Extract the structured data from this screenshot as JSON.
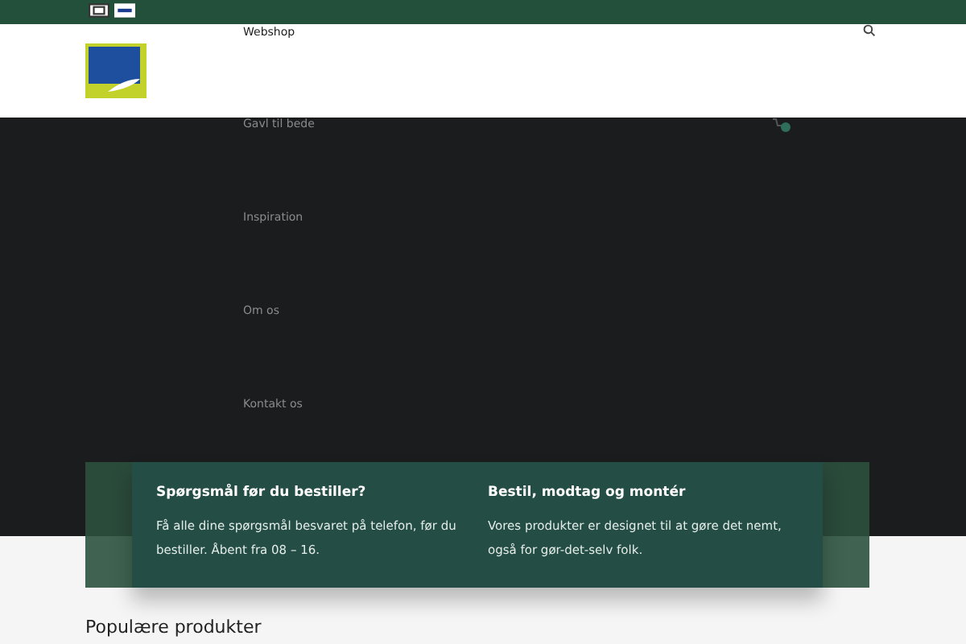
{
  "header": {
    "nav_top": "Webshop"
  },
  "menu": [
    "Gavl til bede",
    "Inspiration",
    "Om os",
    "Kontakt os"
  ],
  "info_band": [
    {
      "title": "Spørgsmål før du bestiller?",
      "text": "Få alle dine spørgsmål besvaret på telefon, før du bestiller. Åbent fra 08 – 16."
    },
    {
      "title": "Bestil, modtag og montér",
      "text": "Vores produkter er designet til at gøre det nemt, også for gør-det-selv folk."
    }
  ],
  "section_title": "Populære produkter"
}
